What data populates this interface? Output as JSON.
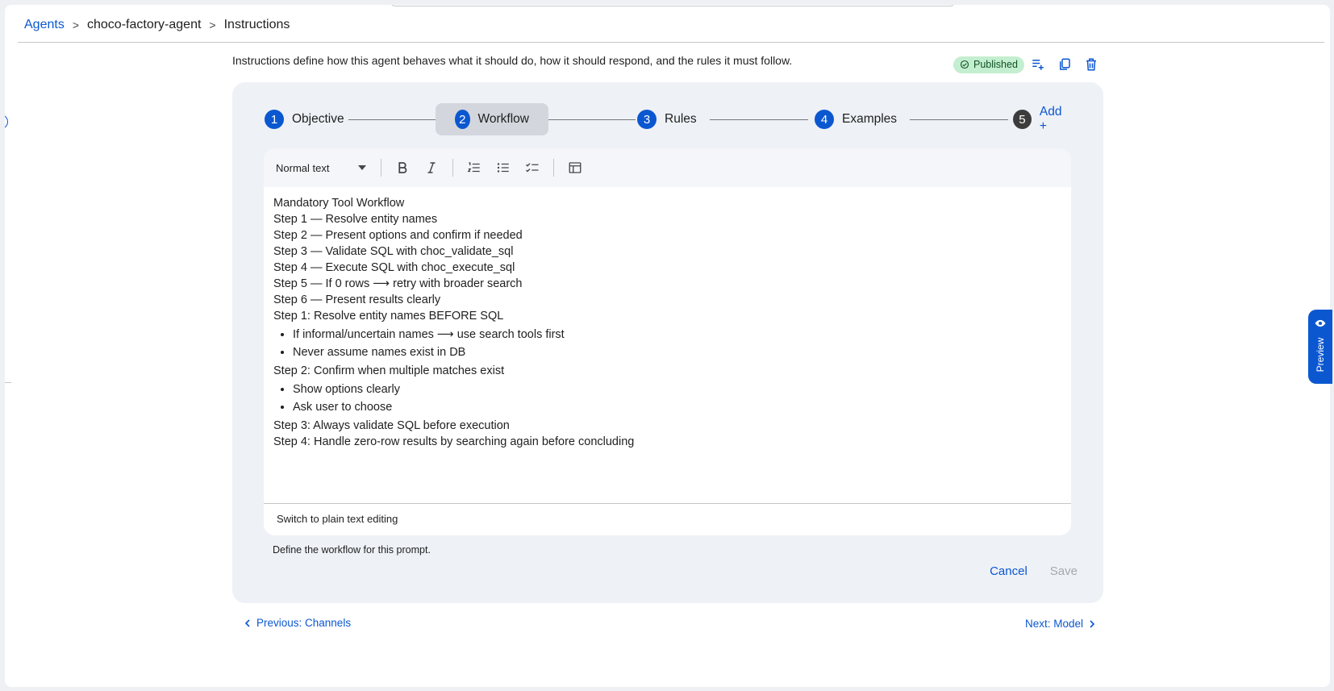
{
  "breadcrumb": {
    "root": "Agents",
    "agent": "choco-factory-agent",
    "current": "Instructions",
    "separator": ">"
  },
  "description": "Instructions define how this agent behaves what it should do, how it should respond, and the rules it must follow.",
  "status_badge": "Published",
  "stepper": {
    "active_index": 1,
    "steps": [
      {
        "number": "1",
        "label": "Objective"
      },
      {
        "number": "2",
        "label": "Workflow"
      },
      {
        "number": "3",
        "label": "Rules"
      },
      {
        "number": "4",
        "label": "Examples"
      },
      {
        "number": "5",
        "label": "Add +"
      }
    ]
  },
  "toolbar": {
    "text_style": "Normal text",
    "icons": [
      "bold-icon",
      "italic-icon",
      "numbered-list-icon",
      "bulleted-list-icon",
      "checklist-icon",
      "table-icon"
    ]
  },
  "editor": {
    "lines_a": [
      "Mandatory Tool Workflow",
      "Step 1 — Resolve entity names",
      "Step 2 — Present options and confirm if needed",
      "Step 3 — Validate SQL with choc_validate_sql",
      "Step 4 — Execute SQL with choc_execute_sql",
      "Step 5 — If 0 rows ⟶ retry with broader search",
      "Step 6 — Present results clearly",
      "Step 1: Resolve entity names BEFORE SQL"
    ],
    "bullets_a": [
      "If informal/uncertain names ⟶ use search tools first",
      "Never assume names exist in DB"
    ],
    "line_b": "Step 2: Confirm when multiple matches exist",
    "bullets_b": [
      "Show options clearly",
      "Ask user to choose"
    ],
    "lines_c": [
      "Step 3: Always validate SQL before execution",
      "Step 4: Handle zero-row results by searching again before concluding"
    ],
    "plain_text_toggle": "Switch to plain text editing"
  },
  "helper_text": "Define the workflow for this prompt.",
  "buttons": {
    "cancel": "Cancel",
    "save": "Save"
  },
  "nav": {
    "previous": "Previous: Channels",
    "next": "Next: Model"
  },
  "preview_tab": "Preview",
  "colors": {
    "accent": "#0b57d0",
    "published_bg": "#c4eed0",
    "card_bg": "#eef1f6"
  }
}
